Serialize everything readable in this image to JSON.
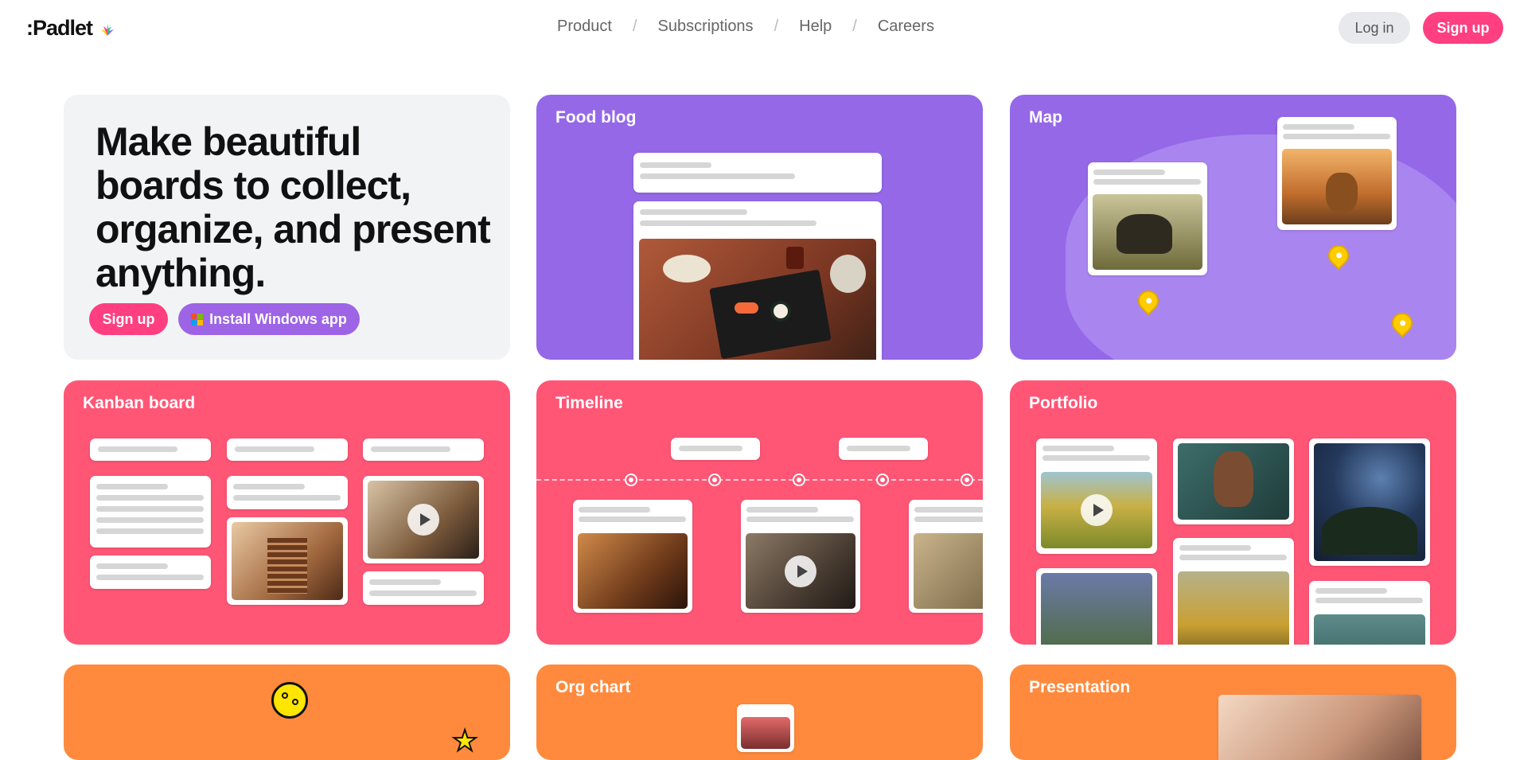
{
  "header": {
    "logo_text": ":Padlet",
    "nav": [
      {
        "label": "Product"
      },
      {
        "label": "Subscriptions"
      },
      {
        "label": "Help"
      },
      {
        "label": "Careers"
      }
    ],
    "separator": "/",
    "login_label": "Log in",
    "signup_label": "Sign up"
  },
  "hero": {
    "title": "Make beautiful boards to collect, organize, and present anything.",
    "signup_label": "Sign up",
    "install_label": "Install Windows app"
  },
  "cards": {
    "food_blog": "Food blog",
    "map": "Map",
    "kanban": "Kanban board",
    "timeline": "Timeline",
    "portfolio": "Portfolio",
    "org_chart": "Org chart",
    "presentation": "Presentation"
  },
  "colors": {
    "brand_pink": "#ff3f7f",
    "purple": "#9568e8",
    "pink": "#ff5676",
    "orange": "#ff8a3d",
    "hero_bg": "#f2f3f5"
  }
}
